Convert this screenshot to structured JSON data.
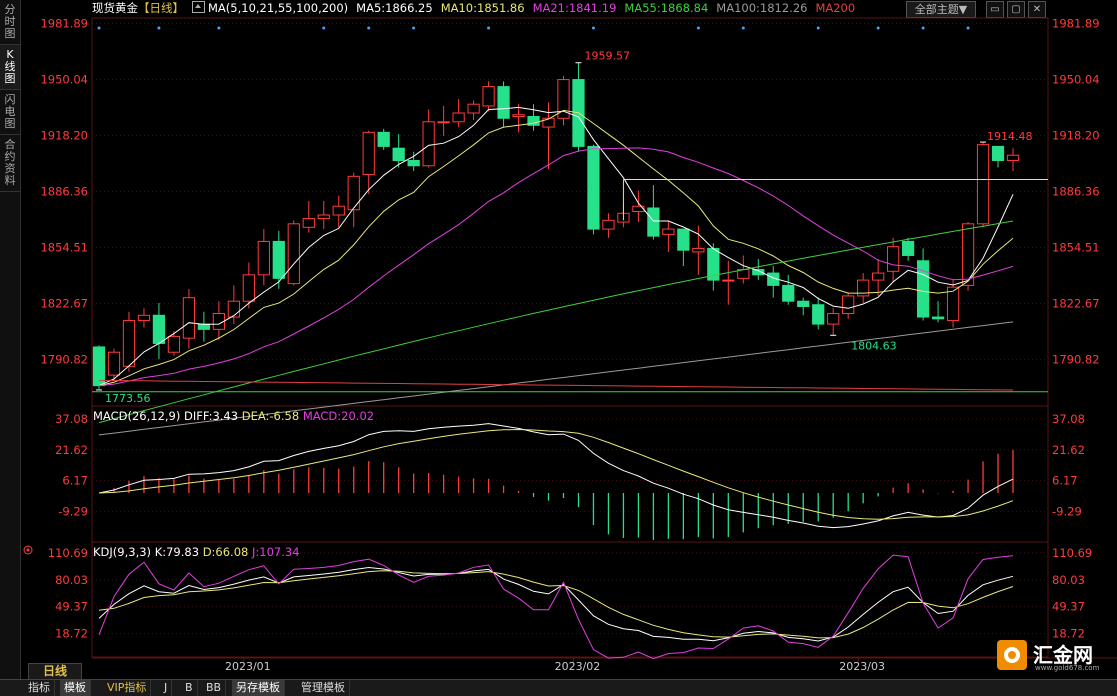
{
  "side_tabs": [
    "分时图",
    "K线图",
    "闪电图",
    "合约资料"
  ],
  "header": {
    "instrument": "现货黄金",
    "period_tag": "【日线】",
    "ma_summary": "MA(5,10,21,55,100,200)",
    "ma5": "MA5:1866.25",
    "ma10": "MA10:1851.86",
    "ma21": "MA21:1841.19",
    "ma55": "MA55:1868.84",
    "ma100": "MA100:1812.26",
    "ma200": "MA200",
    "theme_select": "全部主题▼"
  },
  "colors": {
    "up": "#ff3b3b",
    "down": "#27e08a",
    "ma5": "#ffffff",
    "ma10": "#e8e879",
    "ma21": "#e040e0",
    "ma55": "#3fcf3f",
    "ma100": "#9a9a9a",
    "ma200": "#e04040",
    "axis": "#ff3b3b"
  },
  "price_axis": {
    "ticks": [
      1981.89,
      1950.04,
      1918.2,
      1886.36,
      1854.51,
      1822.67,
      1790.82
    ],
    "labels": [
      "1981.89",
      "1950.04",
      "1918.20",
      "1886.36",
      "1854.51",
      "1822.67",
      "1790.82"
    ],
    "range": [
      1765,
      1985
    ]
  },
  "annotations": {
    "high": "1959.57",
    "high_value": 1959.57,
    "last_high": "1914.48",
    "last_high_value": 1914.48,
    "low_mid": "1804.63",
    "low_mid_value": 1804.63,
    "low_left": "1773.56",
    "low_left_value": 1773.56,
    "hline_value": 1893.2,
    "support_value": 1772.5
  },
  "macd": {
    "label": "MACD(26,12,9)",
    "diff": "DIFF:3.43",
    "dea": "DEA:-6.58",
    "macd": "MACD:20.02",
    "ticks": [
      "37.08",
      "21.62",
      "6.17",
      "-9.29"
    ]
  },
  "kdj": {
    "label": "KDJ(9,3,3)",
    "k": "K:79.83",
    "d": "D:66.08",
    "j": "J:107.34",
    "ticks": [
      "110.69",
      "80.03",
      "49.37",
      "18.72"
    ]
  },
  "x_axis": {
    "labels": [
      "2023/01",
      "2023/02",
      "2023/03"
    ]
  },
  "period_button": "日线",
  "bottom_tabs": [
    "指标",
    "模板",
    "VIP指标",
    "J",
    "B",
    "BB",
    "另存模板",
    "管理模板"
  ],
  "brand": {
    "name": "汇金网",
    "url": "www.gold678.com"
  },
  "chart_data": {
    "type": "candlestick",
    "x": [
      "2022/12/16",
      "2022/12/19",
      "2022/12/20",
      "2022/12/21",
      "2022/12/22",
      "2022/12/23",
      "2022/12/27",
      "2022/12/28",
      "2022/12/29",
      "2022/12/30",
      "2023/01/03",
      "2023/01/04",
      "2023/01/05",
      "2023/01/06",
      "2023/01/09",
      "2023/01/10",
      "2023/01/11",
      "2023/01/12",
      "2023/01/13",
      "2023/01/16",
      "2023/01/17",
      "2023/01/18",
      "2023/01/19",
      "2023/01/20",
      "2023/01/23",
      "2023/01/24",
      "2023/01/25",
      "2023/01/26",
      "2023/01/27",
      "2023/01/30",
      "2023/01/31",
      "2023/02/01",
      "2023/02/02",
      "2023/02/03",
      "2023/02/06",
      "2023/02/07",
      "2023/02/08",
      "2023/02/09",
      "2023/02/10",
      "2023/02/13",
      "2023/02/14",
      "2023/02/15",
      "2023/02/16",
      "2023/02/17",
      "2023/02/20",
      "2023/02/21",
      "2023/02/22",
      "2023/02/23",
      "2023/02/24",
      "2023/02/27",
      "2023/02/28",
      "2023/03/01",
      "2023/03/02",
      "2023/03/03",
      "2023/03/06",
      "2023/03/07",
      "2023/03/08",
      "2023/03/09",
      "2023/03/10",
      "2023/03/13",
      "2023/03/14",
      "2023/03/15"
    ],
    "ohlc": [
      [
        1798,
        1799,
        1774,
        1776
      ],
      [
        1782,
        1797,
        1779,
        1795
      ],
      [
        1787,
        1818,
        1784,
        1813
      ],
      [
        1813,
        1820,
        1809,
        1816
      ],
      [
        1816,
        1823,
        1791,
        1800
      ],
      [
        1795,
        1807,
        1793,
        1804
      ],
      [
        1803,
        1831,
        1797,
        1826
      ],
      [
        1811,
        1818,
        1801,
        1808
      ],
      [
        1808,
        1824,
        1802,
        1817
      ],
      [
        1815,
        1833,
        1811,
        1824
      ],
      [
        1824,
        1846,
        1820,
        1839
      ],
      [
        1839,
        1865,
        1833,
        1858
      ],
      [
        1858,
        1864,
        1831,
        1837
      ],
      [
        1834,
        1870,
        1833,
        1868
      ],
      [
        1866,
        1881,
        1863,
        1871
      ],
      [
        1871,
        1881,
        1865,
        1873
      ],
      [
        1873,
        1884,
        1866,
        1878
      ],
      [
        1876,
        1897,
        1866,
        1895
      ],
      [
        1896,
        1921,
        1885,
        1920
      ],
      [
        1920,
        1922,
        1910,
        1912
      ],
      [
        1911,
        1919,
        1900,
        1904
      ],
      [
        1904,
        1909,
        1898,
        1901
      ],
      [
        1901,
        1933,
        1900,
        1926
      ],
      [
        1926,
        1935,
        1918,
        1926
      ],
      [
        1926,
        1939,
        1923,
        1931
      ],
      [
        1931,
        1938,
        1927,
        1936
      ],
      [
        1935,
        1949,
        1932,
        1946
      ],
      [
        1946,
        1949,
        1923,
        1928
      ],
      [
        1929,
        1936,
        1920,
        1930
      ],
      [
        1929,
        1936,
        1921,
        1924
      ],
      [
        1923,
        1937,
        1899,
        1928
      ],
      [
        1928,
        1952,
        1924,
        1950
      ],
      [
        1950,
        1959.57,
        1909,
        1912
      ],
      [
        1912,
        1913,
        1862,
        1865
      ],
      [
        1865,
        1874,
        1860,
        1870
      ],
      [
        1869,
        1879,
        1866,
        1874
      ],
      [
        1875,
        1887,
        1869,
        1878
      ],
      [
        1877,
        1890,
        1859,
        1861
      ],
      [
        1862,
        1870,
        1852,
        1865
      ],
      [
        1865,
        1865,
        1844,
        1853
      ],
      [
        1852,
        1867,
        1839,
        1854
      ],
      [
        1854,
        1857,
        1830,
        1836
      ],
      [
        1836,
        1847,
        1822,
        1836
      ],
      [
        1837,
        1850,
        1834,
        1842
      ],
      [
        1842,
        1848,
        1836,
        1839
      ],
      [
        1840,
        1844,
        1826,
        1833
      ],
      [
        1833,
        1839,
        1822,
        1824
      ],
      [
        1824,
        1826,
        1816,
        1821
      ],
      [
        1822,
        1826,
        1808,
        1811
      ],
      [
        1811,
        1820,
        1804.63,
        1817
      ],
      [
        1817,
        1829,
        1814,
        1827
      ],
      [
        1827,
        1840,
        1823,
        1836
      ],
      [
        1836,
        1848,
        1827,
        1840
      ],
      [
        1841,
        1860,
        1835,
        1855
      ],
      [
        1858,
        1860,
        1847,
        1850
      ],
      [
        1847,
        1854,
        1813,
        1815
      ],
      [
        1815,
        1824,
        1812,
        1814
      ],
      [
        1813,
        1836,
        1809,
        1832
      ],
      [
        1833,
        1869,
        1830,
        1868
      ],
      [
        1868,
        1914.48,
        1866,
        1913
      ],
      [
        1912,
        1912,
        1900,
        1904
      ],
      [
        1904,
        1911,
        1898,
        1907
      ]
    ]
  }
}
